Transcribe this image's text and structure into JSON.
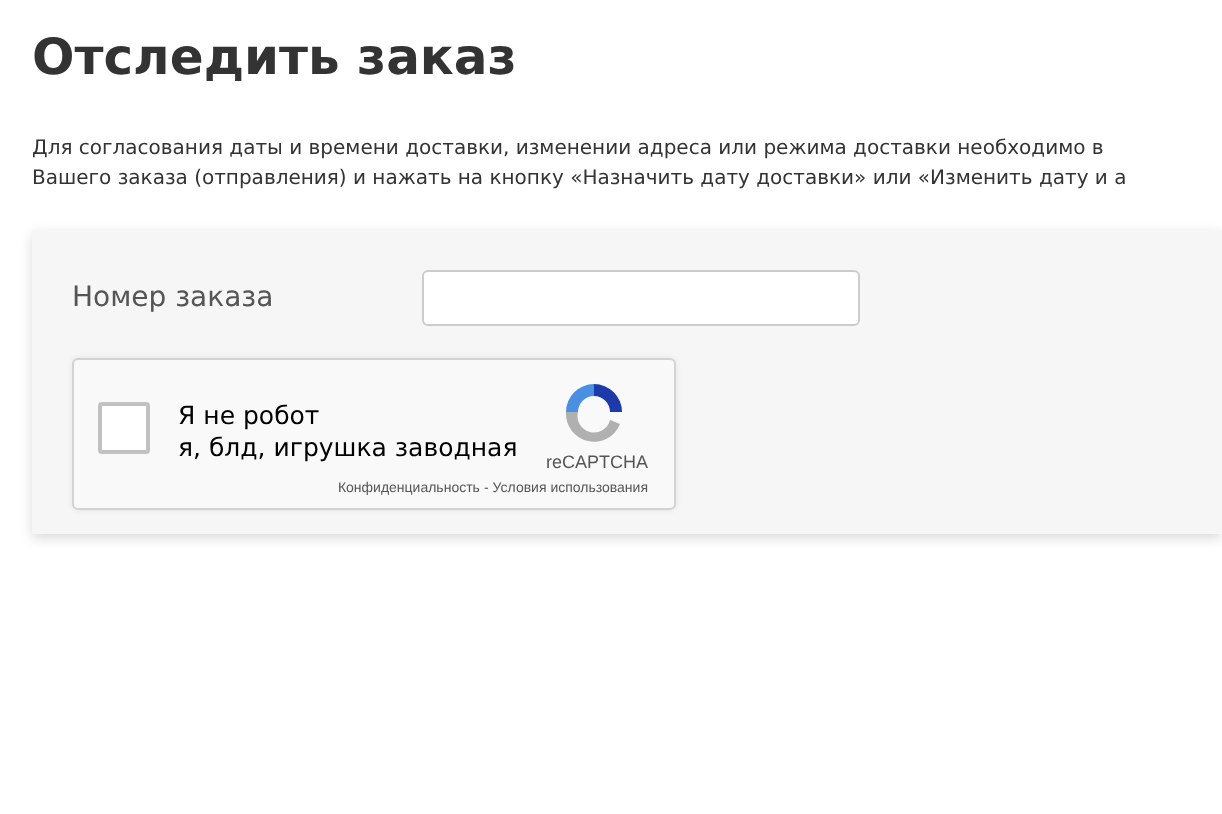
{
  "title": "Отследить заказ",
  "intro_lines": [
    "Для согласования даты и времени доставки, изменении адреса или режима доставки необходимо в",
    "Вашего заказа (отправления) и нажать на кнопку «Назначить дату доставки» или «Изменить дату и а"
  ],
  "form": {
    "order_label": "Номер заказа",
    "captcha": {
      "checked": false,
      "label_lines": [
        "Я не робот",
        "я, блд, игрушка заводная"
      ],
      "brand": "reCAPTCHA",
      "privacy": "Конфиденциальность",
      "separator": "-",
      "terms": "Условия использования"
    }
  }
}
